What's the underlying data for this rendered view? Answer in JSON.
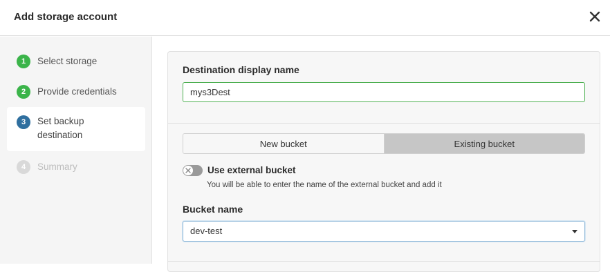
{
  "dialog": {
    "title": "Add storage account"
  },
  "steps": [
    {
      "number": "1",
      "label": "Select storage",
      "state": "done"
    },
    {
      "number": "2",
      "label": "Provide credentials",
      "state": "done"
    },
    {
      "number": "3",
      "label_line1": "Set backup",
      "label_line2": "destination",
      "state": "active"
    },
    {
      "number": "4",
      "label": "Summary",
      "state": "pending"
    }
  ],
  "form": {
    "destination_label": "Destination display name",
    "destination_value": "mys3Dest",
    "bucket_mode": {
      "options": [
        "New bucket",
        "Existing bucket"
      ],
      "selected": "Existing bucket"
    },
    "external_toggle": {
      "label": "Use external bucket",
      "on": false,
      "helper": "You will be able to enter the name of the external bucket and add it"
    },
    "bucket_name_label": "Bucket name",
    "bucket_name_value": "dev-test"
  },
  "colors": {
    "done": "#3bb44a",
    "active": "#2f6f9f",
    "pending": "#d9d9d9",
    "input_border": "#4caf50",
    "selected_segment": "#c6c6c6"
  },
  "icons": {
    "close": "close-icon",
    "toggle_off": "x-icon",
    "dropdown": "caret-down-icon"
  }
}
